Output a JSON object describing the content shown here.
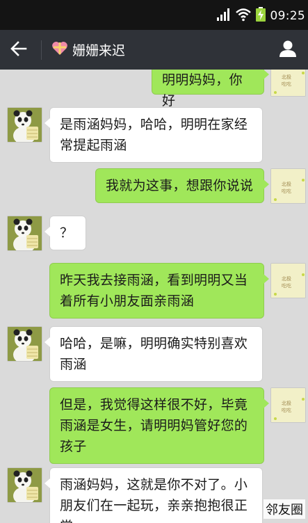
{
  "status_bar": {
    "time": "09:25",
    "icons": [
      "signal-icon",
      "wifi-icon",
      "battery-charging-icon"
    ]
  },
  "nav": {
    "title": "姗姗来迟",
    "back_icon": "arrow-left-icon",
    "title_icon": "heart-gift-icon",
    "contact_icon": "person-icon"
  },
  "colors": {
    "nav_bg": "#2f3238",
    "status_bg": "#141414",
    "chat_bg": "#dadada",
    "outgoing_bubble": "#a0e75a",
    "incoming_bubble": "#ffffff"
  },
  "messages": [
    {
      "side": "out",
      "text": "明明妈妈，你好"
    },
    {
      "side": "in",
      "text": "是雨涵妈妈，哈哈，明明在家经常提起雨涵"
    },
    {
      "side": "out",
      "text": "我就为这事，想跟你说说"
    },
    {
      "side": "in",
      "text": "？"
    },
    {
      "side": "out",
      "text": "昨天我去接雨涵，看到明明又当着所有小朋友面亲雨涵"
    },
    {
      "side": "in",
      "text": "哈哈，是嘛，明明确实特别喜欢雨涵"
    },
    {
      "side": "out",
      "text": "但是，我觉得这样很不好，毕竟雨涵是女生，请明明妈管好您的孩子"
    },
    {
      "side": "in",
      "text": "雨涵妈妈，这就是你不对了。小朋友们在一起玩，亲亲抱抱很正常"
    }
  ],
  "watermark": "邻友圈"
}
